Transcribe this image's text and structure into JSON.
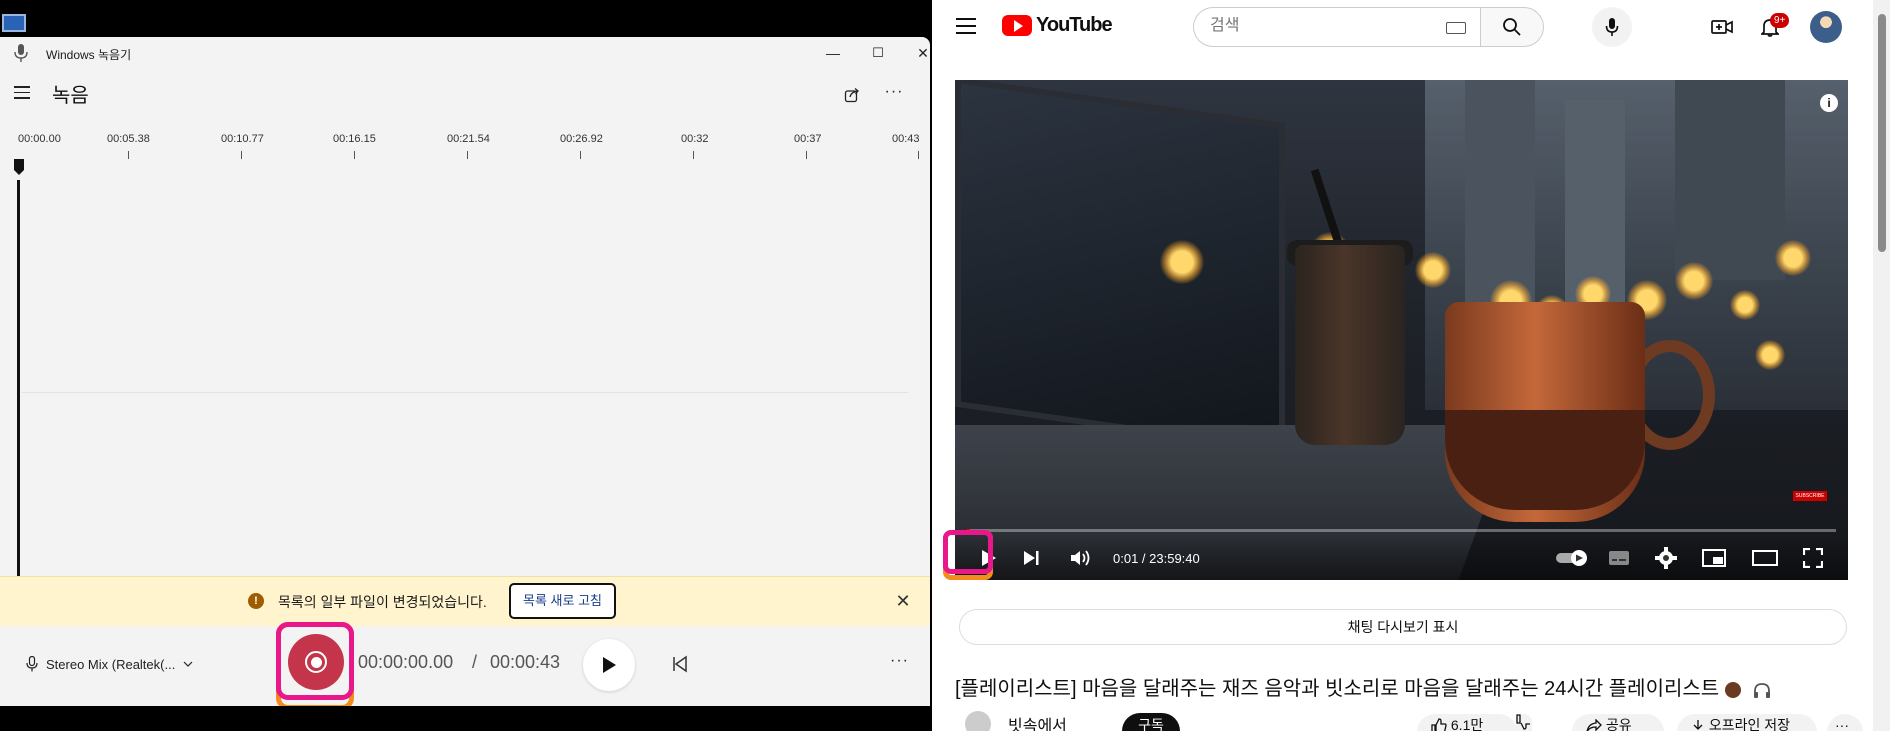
{
  "recorder": {
    "window_title": "Windows 녹음기",
    "page_title": "녹음",
    "win_controls": {
      "minimize": "—",
      "maximize": "☐",
      "close": "✕"
    },
    "more": "···",
    "ticks": [
      "00:00.00",
      "00:05.38",
      "00:10.77",
      "00:16.15",
      "00:21.54",
      "00:26.92",
      "00:32",
      "00:37",
      "00:43"
    ],
    "notice": {
      "message": "목록의 일부 파일이 변경되었습니다.",
      "refresh_label": "목록 새로 고침",
      "close": "✕",
      "warn": "!"
    },
    "input_device": "Stereo Mix (Realtek(...",
    "time_current": "00:00:00.00",
    "time_separator": "/",
    "time_total": "00:00:43"
  },
  "youtube": {
    "logo_text": "YouTube",
    "search_placeholder": "검색",
    "notification_badge": "9+",
    "video": {
      "time_display": "0:01 / 23:59:40",
      "progress": 1.16e-05,
      "subscribe_mark": "SUBSCRIBE",
      "info": "i"
    },
    "chat_replay_label": "채팅 다시보기 표시",
    "video_title": "[플레이리스트] 마음을 달래주는 재즈 음악과 빗소리로 마음을 달래주는 24시간 플레이리스트",
    "channel_name": "빗속에서",
    "subscribe_label": "구독",
    "like_count": "6.1만",
    "share_label": "공유",
    "offline_save_label": "오프라인 저장",
    "more": "···"
  },
  "colors": {
    "record_red": "#c4344a",
    "highlight_orange": "#f48b1f",
    "highlight_pink": "#e8178a",
    "notice_bg": "#fff4ce",
    "yt_red": "#ff0000"
  }
}
